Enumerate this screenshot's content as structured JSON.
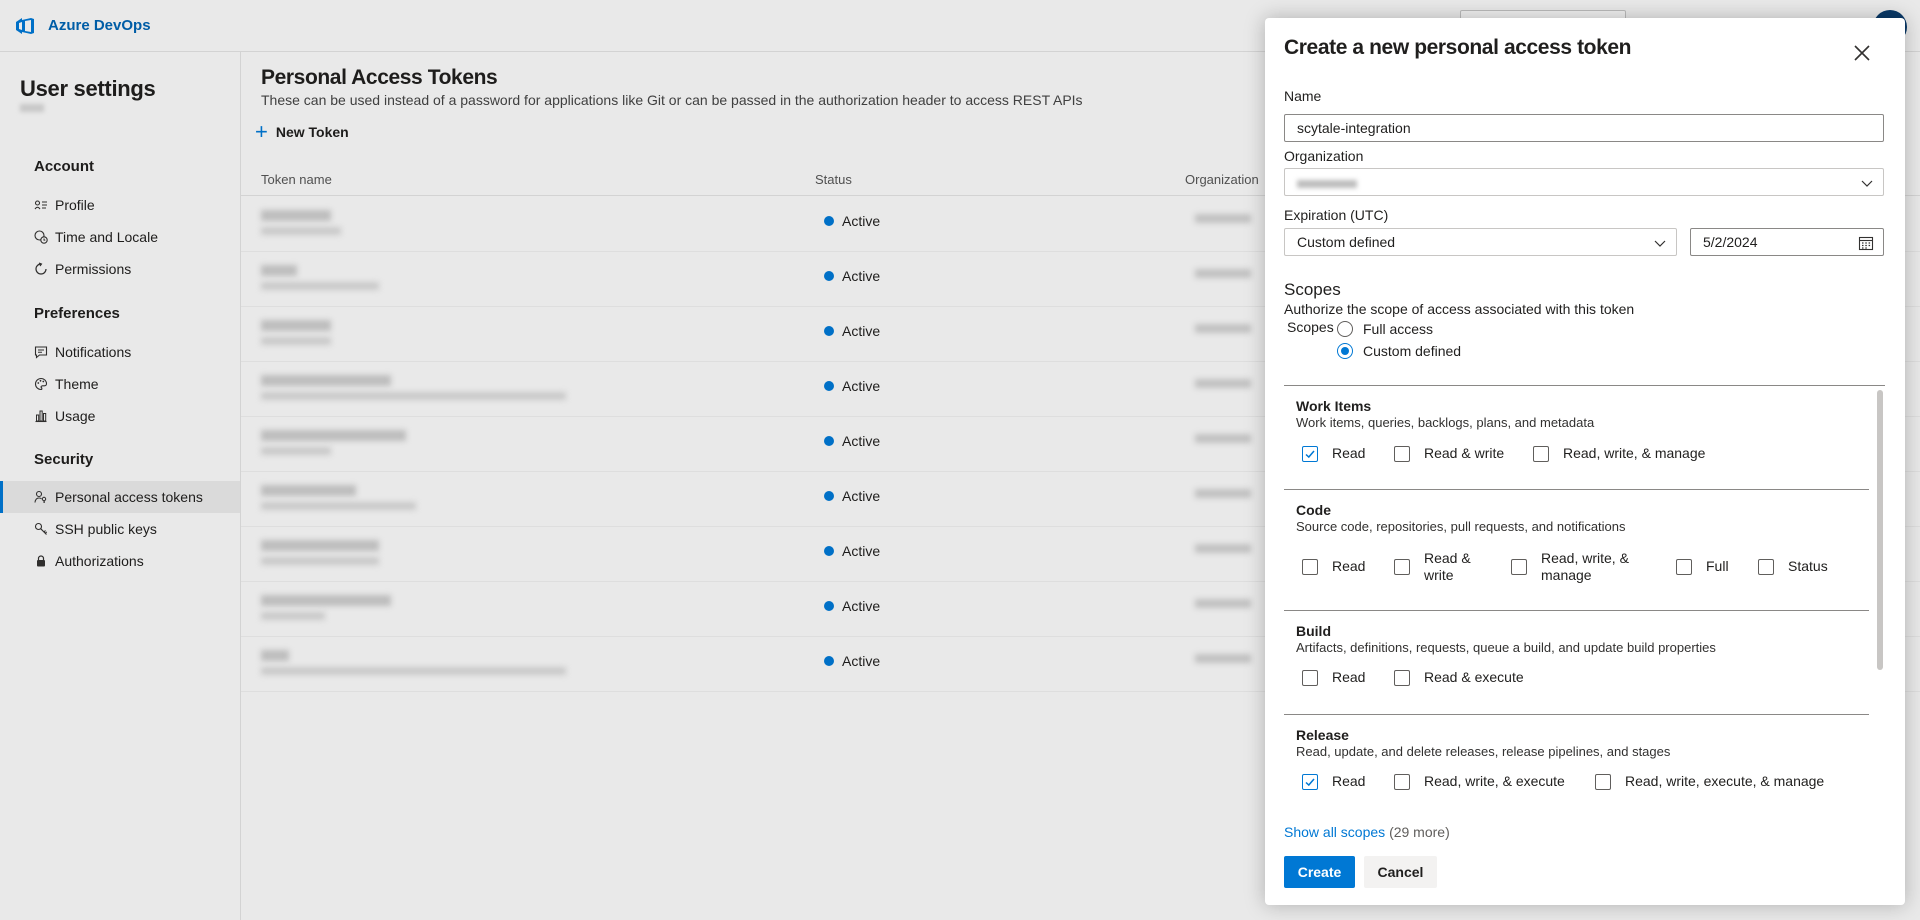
{
  "topbar": {
    "brand": "Azure DevOps"
  },
  "sidebar": {
    "title": "User settings",
    "sections": {
      "account": "Account",
      "preferences": "Preferences",
      "security": "Security"
    },
    "items": {
      "profile": "Profile",
      "time_locale": "Time and Locale",
      "permissions": "Permissions",
      "notifications": "Notifications",
      "theme": "Theme",
      "usage": "Usage",
      "pat": "Personal access tokens",
      "ssh": "SSH public keys",
      "authorizations": "Authorizations"
    }
  },
  "main": {
    "title": "Personal Access Tokens",
    "description": "These can be used instead of a password for applications like Git or can be passed in the authorization header to access REST APIs",
    "new_token": "New Token",
    "columns": {
      "name": "Token name",
      "status": "Status",
      "organization": "Organization"
    },
    "rows": [
      {
        "status": "Active"
      },
      {
        "status": "Active"
      },
      {
        "status": "Active"
      },
      {
        "status": "Active"
      },
      {
        "status": "Active"
      },
      {
        "status": "Active"
      },
      {
        "status": "Active"
      },
      {
        "status": "Active"
      },
      {
        "status": "Active"
      }
    ]
  },
  "panel": {
    "title": "Create a new personal access token",
    "name_label": "Name",
    "name_value": "scytale-integration",
    "org_label": "Organization",
    "expiration_label": "Expiration (UTC)",
    "expiration_value": "Custom defined",
    "date_value": "5/2/2024",
    "scopes_heading": "Scopes",
    "scopes_desc": "Authorize the scope of access associated with this token",
    "scopes_label": "Scopes",
    "radio_full": "Full access",
    "radio_custom": "Custom defined",
    "radio_selected": "custom",
    "sections": {
      "work_items": {
        "title": "Work Items",
        "desc": "Work items, queries, backlogs, plans, and metadata",
        "options": [
          "Read",
          "Read & write",
          "Read, write, & manage"
        ],
        "checked": [
          true,
          false,
          false
        ]
      },
      "code": {
        "title": "Code",
        "desc": "Source code, repositories, pull requests, and notifications",
        "options": [
          "Read",
          "Read & write",
          "Read, write, & manage",
          "Full",
          "Status"
        ],
        "checked": [
          false,
          false,
          false,
          false,
          false
        ]
      },
      "build": {
        "title": "Build",
        "desc": "Artifacts, definitions, requests, queue a build, and update build properties",
        "options": [
          "Read",
          "Read & execute"
        ],
        "checked": [
          false,
          false
        ]
      },
      "release": {
        "title": "Release",
        "desc": "Read, update, and delete releases, release pipelines, and stages",
        "options": [
          "Read",
          "Read, write, & execute",
          "Read, write, execute, & manage"
        ],
        "checked": [
          true,
          false,
          false
        ]
      }
    },
    "show_all": "Show all scopes",
    "more_count": "(29 more)",
    "create": "Create",
    "cancel": "Cancel"
  },
  "colors": {
    "accent": "#0078d4",
    "brand": "#0063b1"
  }
}
